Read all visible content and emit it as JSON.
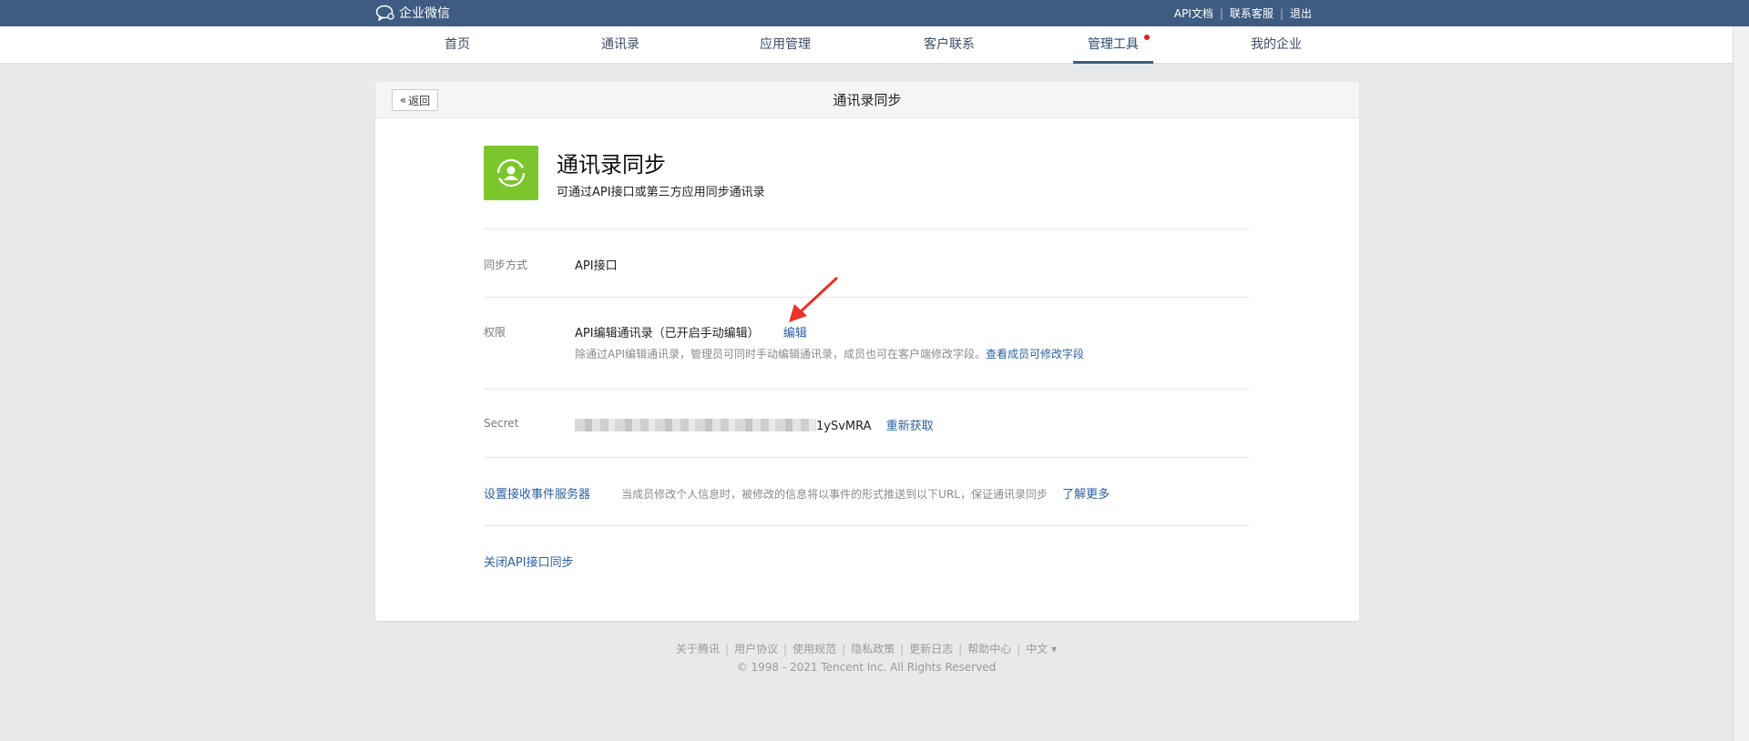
{
  "topbar": {
    "logo_text": "企业微信",
    "links": [
      "API文档",
      "联系客服",
      "退出"
    ]
  },
  "nav": {
    "items": [
      "首页",
      "通讯录",
      "应用管理",
      "客户联系",
      "管理工具",
      "我的企业"
    ],
    "active": "管理工具"
  },
  "card": {
    "back_label": "返回",
    "title": "通讯录同步",
    "app_name": "通讯录同步",
    "app_desc": "可通过API接口或第三方应用同步通讯录",
    "sync": {
      "label": "同步方式",
      "value": "API接口"
    },
    "perm": {
      "label": "权限",
      "value": "API编辑通讯录（已开启手动编辑）",
      "edit_link": "编辑",
      "hint": "除通过API编辑通讯录，管理员可同时手动编辑通讯录，成员也可在客户端修改字段。",
      "hint_link": "查看成员可修改字段"
    },
    "secret": {
      "label": "Secret",
      "suffix": "1ySvMRA",
      "refresh_link": "重新获取"
    },
    "event": {
      "link": "设置接收事件服务器",
      "desc": "当成员修改个人信息时，被修改的信息将以事件的形式推送到以下URL，保证通讯录同步",
      "more_link": "了解更多"
    },
    "close_link": "关闭API接口同步"
  },
  "footer": {
    "links": [
      "关于腾讯",
      "用户协议",
      "使用规范",
      "隐私政策",
      "更新日志",
      "帮助中心",
      "中文 ▾"
    ],
    "copyright": "© 1998 - 2021 Tencent Inc. All Rights Reserved"
  },
  "colors": {
    "topbar": "#3e5c81",
    "link": "#2b5fa1",
    "app_icon": "#7cc62d",
    "badge": "#e0201a",
    "arrow": "#e8322b"
  }
}
